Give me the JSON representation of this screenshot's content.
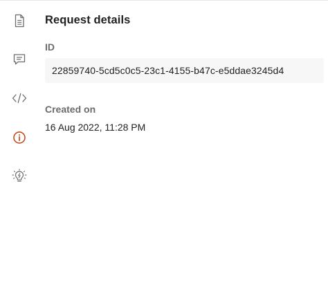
{
  "sidebar": {
    "items": [
      {
        "icon": "document-icon",
        "color": "#6b6b6b"
      },
      {
        "icon": "comment-icon",
        "color": "#6b6b6b"
      },
      {
        "icon": "code-icon",
        "color": "#6b6b6b"
      },
      {
        "icon": "info-icon",
        "color": "#c2410c",
        "active": true
      },
      {
        "icon": "lightbulb-icon",
        "color": "#6b6b6b"
      }
    ]
  },
  "panel": {
    "title": "Request details",
    "id_label": "ID",
    "id_value": "22859740-5cd5c0c5-23c1-4155-b47c-e5ddae3245d4",
    "created_label": "Created on",
    "created_value": "16 Aug 2022, 11:28 PM"
  }
}
